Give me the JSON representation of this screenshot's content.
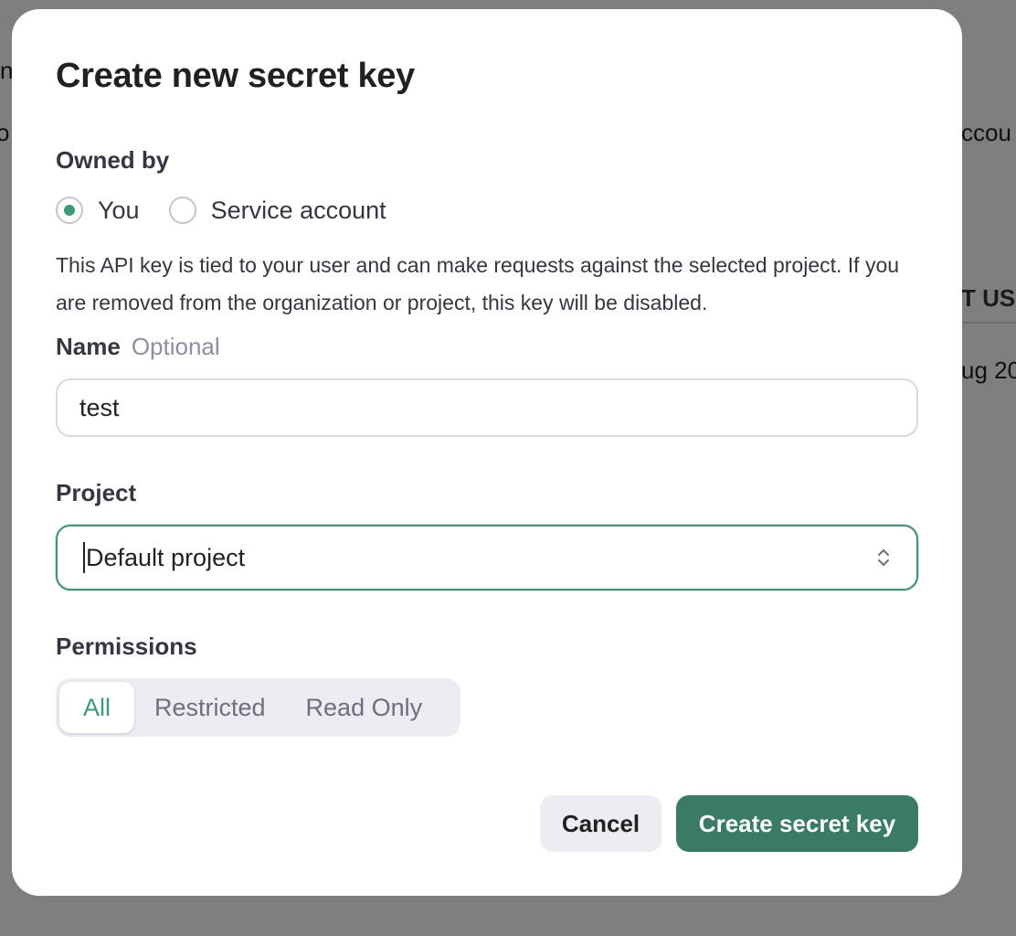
{
  "background": {
    "fragments": [
      {
        "text": "n"
      },
      {
        "text": "o"
      },
      {
        "text": "ccou"
      },
      {
        "text": "T USE"
      },
      {
        "text": "ug 20"
      }
    ]
  },
  "modal": {
    "title": "Create new secret key",
    "owned_by": {
      "label": "Owned by",
      "options": [
        {
          "label": "You",
          "checked": true
        },
        {
          "label": "Service account",
          "checked": false
        }
      ],
      "description": "This API key is tied to your user and can make requests against the selected project. If you are removed from the organization or project, this key will be disabled."
    },
    "name": {
      "label": "Name",
      "optional_label": "Optional",
      "value": "test"
    },
    "project": {
      "label": "Project",
      "value": "Default project"
    },
    "permissions": {
      "label": "Permissions",
      "options": [
        {
          "label": "All",
          "active": true
        },
        {
          "label": "Restricted",
          "active": false
        },
        {
          "label": "Read Only",
          "active": false
        }
      ]
    },
    "actions": {
      "cancel_label": "Cancel",
      "create_label": "Create secret key"
    }
  },
  "colors": {
    "accent": "#3c9a78",
    "primary_button": "#3b7b64",
    "overlay": "rgba(0,0,0,0.5)"
  },
  "icons": {
    "select_chevron": "chevron-up-down-icon"
  }
}
